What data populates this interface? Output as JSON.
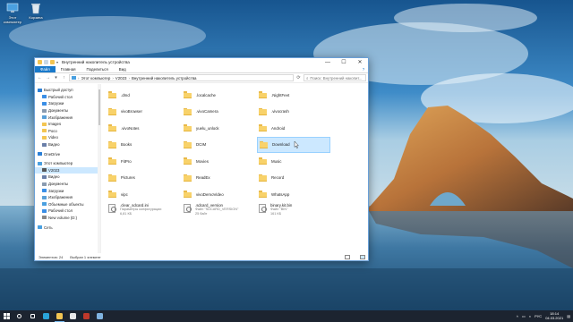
{
  "desktop": {
    "icons": [
      {
        "label": "Этот компьютер"
      },
      {
        "label": "Корзина"
      }
    ]
  },
  "window": {
    "title": "Внутренний накопитель устройства",
    "controls": {
      "minimize": "—",
      "maximize": "☐",
      "close": "✕"
    },
    "ribbon_tabs": [
      "Файл",
      "Главная",
      "Поделиться",
      "Вид"
    ],
    "help": "?",
    "address": {
      "crumbs": [
        "Этот компьютер",
        "V2023",
        "Внутренний накопитель устройства"
      ],
      "search_placeholder": "Поиск: Внутренний накопит..."
    },
    "nav_pane": [
      {
        "label": "Быстрый доступ",
        "icon": "star-icon",
        "color": "#2b7fd6"
      },
      {
        "label": "Рабочий стол",
        "icon": "desktop-icon",
        "color": "#3a8ee6"
      },
      {
        "label": "Загрузки",
        "icon": "download-icon",
        "color": "#3a8ee6"
      },
      {
        "label": "Документы",
        "icon": "documents-icon",
        "color": "#8a9bb0"
      },
      {
        "label": "Изображения",
        "icon": "pictures-icon",
        "color": "#5aa0d8"
      },
      {
        "label": "Images",
        "icon": "folder-icon",
        "color": "#f3c552"
      },
      {
        "label": "Poco",
        "icon": "folder-icon",
        "color": "#f3c552"
      },
      {
        "label": "Video",
        "icon": "folder-icon",
        "color": "#f3c552"
      },
      {
        "label": "Видео",
        "icon": "videos-icon",
        "color": "#6a7fa8"
      },
      {
        "label": "OneDrive",
        "icon": "cloud-icon",
        "color": "#2b7fd6"
      },
      {
        "label": "Этот компьютер",
        "icon": "computer-icon",
        "color": "#4aa0e0"
      },
      {
        "label": "V2023",
        "icon": "phone-icon",
        "color": "#555555"
      },
      {
        "label": "Видео",
        "icon": "videos-icon",
        "color": "#6a7fa8"
      },
      {
        "label": "Документы",
        "icon": "documents-icon",
        "color": "#8a9bb0"
      },
      {
        "label": "Загрузки",
        "icon": "download-icon",
        "color": "#3a8ee6"
      },
      {
        "label": "Изображения",
        "icon": "pictures-icon",
        "color": "#5aa0d8"
      },
      {
        "label": "Объемные объекты",
        "icon": "3d-objects-icon",
        "color": "#4aa0e0"
      },
      {
        "label": "Рабочий стол",
        "icon": "desktop-icon",
        "color": "#3a8ee6"
      },
      {
        "label": "New volume (D:)",
        "icon": "drive-icon",
        "color": "#888888"
      },
      {
        "label": "Сеть",
        "icon": "network-icon",
        "color": "#4aa0e0"
      }
    ],
    "items": [
      {
        "name": ".dmd",
        "type": "folder"
      },
      {
        "name": ".localcache",
        "type": "folder"
      },
      {
        "name": ".NightFeet",
        "type": "folder"
      },
      {
        "name": "vivoBrowser",
        "type": "folder"
      },
      {
        "name": ".vivoCamera",
        "type": "folder"
      },
      {
        "name": ".vivocrash",
        "type": "folder"
      },
      {
        "name": ".vivoNotes",
        "type": "folder"
      },
      {
        "name": "yuelu_unlock",
        "type": "folder"
      },
      {
        "name": "Android",
        "type": "folder"
      },
      {
        "name": "Books",
        "type": "folder"
      },
      {
        "name": "DCIM",
        "type": "folder"
      },
      {
        "name": "Download",
        "type": "folder",
        "selected": true
      },
      {
        "name": "FitPro",
        "type": "folder"
      },
      {
        "name": "Movies",
        "type": "folder"
      },
      {
        "name": "Music",
        "type": "folder"
      },
      {
        "name": "Pictures",
        "type": "folder"
      },
      {
        "name": "ReadEx",
        "type": "folder"
      },
      {
        "name": "Record",
        "type": "folder"
      },
      {
        "name": "vipc",
        "type": "folder"
      },
      {
        "name": "vivoDemoVideo",
        "type": "folder"
      },
      {
        "name": "WhatsApp",
        "type": "folder"
      },
      {
        "name": ".clear_sdcard.ini",
        "type": "file",
        "kind": "Параметры конфигурации",
        "size": "6,81 КБ"
      },
      {
        "name": ".sdcard_version",
        "type": "file",
        "kind": "Файл \"SDCARD_VERSION\"",
        "size": "25 байт"
      },
      {
        "name": "binary.kit.bin",
        "type": "file",
        "kind": "Файл \"BIN\"",
        "size": "161 КБ"
      }
    ],
    "status": {
      "count": "Элементов: 24",
      "selected": "Выбран 1 элемент"
    }
  },
  "taskbar": {
    "apps": [
      {
        "icon": "search-icon",
        "color": "#ffffff"
      },
      {
        "icon": "task-view-icon",
        "color": "#ffffff"
      },
      {
        "icon": "edge-icon",
        "color": "#2aa3d8"
      },
      {
        "icon": "explorer-icon",
        "color": "#f3c552"
      },
      {
        "icon": "store-icon",
        "color": "#e8e8e8"
      },
      {
        "icon": "browser-icon",
        "color": "#c0392b"
      },
      {
        "icon": "camera-icon",
        "color": "#7fb3e0"
      }
    ],
    "tray": {
      "lang": "РУС",
      "time": "18:14",
      "date": "04.03.2021"
    }
  }
}
